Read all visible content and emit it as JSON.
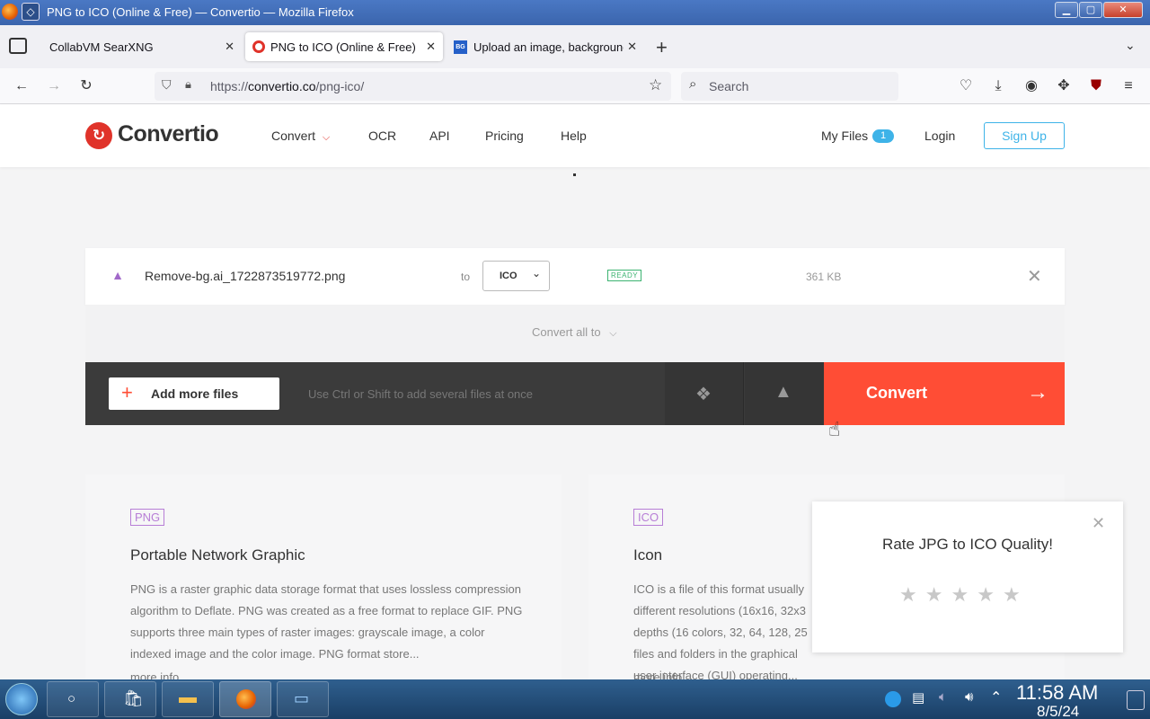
{
  "window": {
    "title": "PNG to ICO (Online & Free) — Convertio — Mozilla Firefox",
    "minimize_glyph": "▁",
    "maximize_glyph": "▢",
    "close_glyph": "✕"
  },
  "tabs": [
    {
      "label": "CollabVM SearXNG",
      "active": false
    },
    {
      "label": "PNG to ICO (Online & Free)",
      "active": true
    },
    {
      "label": "Upload an image, background",
      "active": false
    }
  ],
  "navbar": {
    "url_prefix": "https://",
    "url_domain": "convertio.co",
    "url_path": "/png-ico/",
    "search_placeholder": "Search"
  },
  "site": {
    "logo_text": "Convertio",
    "nav": [
      "Convert",
      "OCR",
      "API",
      "Pricing",
      "Help"
    ],
    "my_files": "My Files",
    "my_files_count": "1",
    "login": "Login",
    "signup": "Sign Up"
  },
  "file": {
    "name": "Remove-bg.ai_1722873519772.png",
    "to_label": "to",
    "format": "ICO",
    "status": "READY",
    "size": "361 KB"
  },
  "convert_all": "Convert all to",
  "actions": {
    "add_more": "Add more files",
    "hint": "Use Ctrl or Shift to add several files at once",
    "convert": "Convert"
  },
  "cards": [
    {
      "tag": "PNG",
      "title": "Portable Network Graphic",
      "desc": "PNG is a raster graphic data storage format that uses lossless compression algorithm to Deflate. PNG was created as a free format to replace GIF. PNG supports three main types of raster images: grayscale image, a color indexed image and the color image. PNG format store...",
      "more": "more info"
    },
    {
      "tag": "ICO",
      "title": "Icon",
      "desc": "ICO is a file of this format usually different resolutions (16x16, 32x3 depths (16 colors, 32, 64, 128, 25 files and folders in the graphical user interface (GUI) operating...",
      "more": "more info"
    }
  ],
  "popup": {
    "title": "Rate JPG to ICO Quality!",
    "rating": 0,
    "max_rating": 5
  },
  "taskbar": {
    "time": "11:58 AM",
    "date": "8/5/24"
  },
  "colors": {
    "accent_red": "#ff4d35",
    "accent_blue": "#3eb3e8",
    "ready_green": "#3cb371",
    "png_tag": "#b77ed6"
  }
}
